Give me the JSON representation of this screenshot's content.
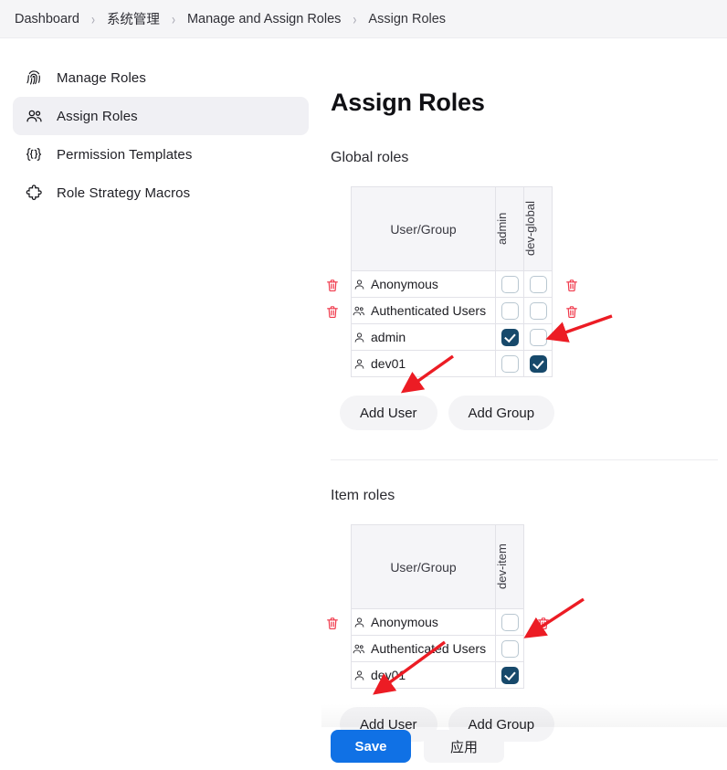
{
  "breadcrumb": {
    "separator": "›",
    "items": [
      {
        "label": "Dashboard"
      },
      {
        "label": "系统管理"
      },
      {
        "label": "Manage and Assign Roles"
      },
      {
        "label": "Assign Roles"
      }
    ]
  },
  "sidebar": {
    "items": [
      {
        "label": "Manage Roles",
        "icon": "fingerprint-icon",
        "active": false
      },
      {
        "label": "Assign Roles",
        "icon": "people-icon",
        "active": true
      },
      {
        "label": "Permission Templates",
        "icon": "curly-braces-icon",
        "active": false
      },
      {
        "label": "Role Strategy Macros",
        "icon": "puzzle-piece-icon",
        "active": false
      }
    ]
  },
  "main": {
    "title": "Assign Roles",
    "global_section": {
      "heading": "Global roles",
      "table": {
        "user_group_header": "User/Group",
        "role_columns": [
          "admin",
          "dev-global"
        ],
        "rows": [
          {
            "name": "Anonymous",
            "icon": "user-icon",
            "deletable": false,
            "checks": [
              false,
              false
            ]
          },
          {
            "name": "Authenticated Users",
            "icon": "group-icon",
            "deletable": false,
            "checks": [
              false,
              false
            ]
          },
          {
            "name": "admin",
            "icon": "user-icon",
            "deletable": true,
            "checks": [
              true,
              false
            ]
          },
          {
            "name": "dev01",
            "icon": "user-icon",
            "deletable": true,
            "checks": [
              false,
              true
            ]
          }
        ]
      },
      "add_user_label": "Add User",
      "add_group_label": "Add Group"
    },
    "item_section": {
      "heading": "Item roles",
      "table": {
        "user_group_header": "User/Group",
        "role_columns": [
          "dev-item"
        ],
        "rows": [
          {
            "name": "Anonymous",
            "icon": "user-icon",
            "deletable": false,
            "checks": [
              false
            ]
          },
          {
            "name": "Authenticated Users",
            "icon": "group-icon",
            "deletable": false,
            "checks": [
              false
            ]
          },
          {
            "name": "dev01",
            "icon": "user-icon",
            "deletable": true,
            "checks": [
              true
            ]
          }
        ]
      },
      "add_user_label": "Add User",
      "add_group_label": "Add Group"
    }
  },
  "footer": {
    "save_label": "Save",
    "apply_label": "应用"
  },
  "colors": {
    "primary_button": "#1071e5",
    "checkbox_checked": "#17496b",
    "delete_icon": "#f0394b",
    "annotation_arrow": "#ec1c24",
    "sidebar_active": "#f0f0f4",
    "table_header": "#f5f5f8"
  },
  "annotations": [
    {
      "name": "arrow-to-dev-global-checkbox",
      "target": "dev01 dev-global checkbox"
    },
    {
      "name": "arrow-to-global-add-user",
      "target": "Global roles Add User button"
    },
    {
      "name": "arrow-to-dev-item-checkbox",
      "target": "dev01 dev-item checkbox"
    },
    {
      "name": "arrow-to-item-add-user",
      "target": "Item roles Add User button"
    }
  ]
}
